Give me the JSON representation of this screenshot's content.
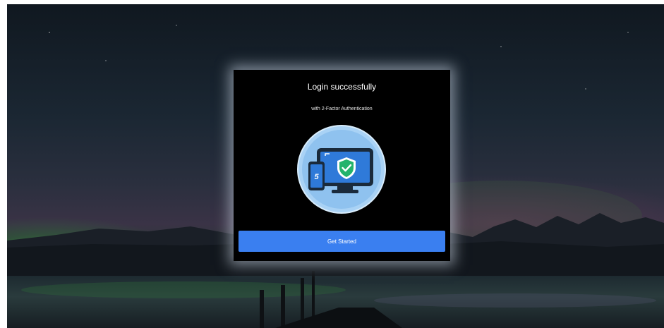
{
  "dialog": {
    "title": "Login successfully",
    "subtitle": "with 2-Factor Authentication",
    "illustration_icon": "devices-shield-icon",
    "phone_glyph": "5",
    "primary_button_label": "Get Started"
  },
  "colors": {
    "dialog_background": "#000000",
    "button": "#3a7ff0",
    "illustration_circle": "#a9d2f5",
    "shield": "#24b36b"
  }
}
